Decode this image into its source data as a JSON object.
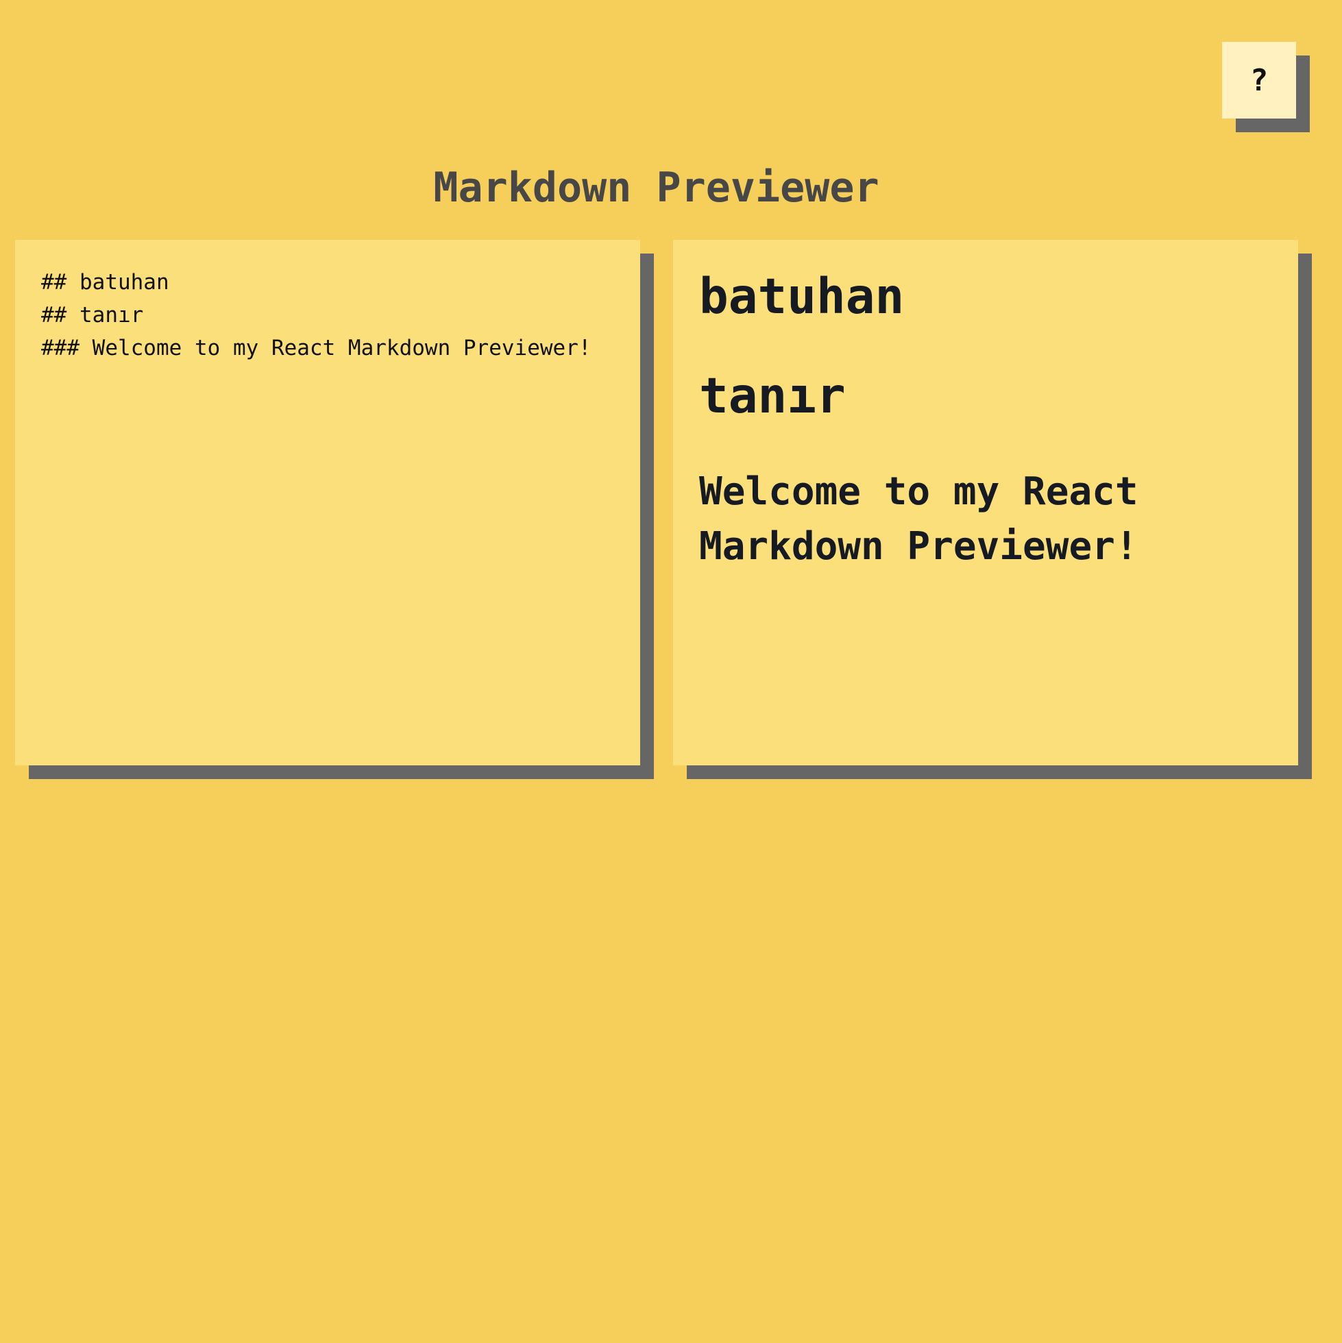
{
  "help_button": {
    "label": "?"
  },
  "header": {
    "title": "Markdown Previewer"
  },
  "editor": {
    "content": "## batuhan\n## tanır\n### Welcome to my React Markdown Previewer!"
  },
  "preview": {
    "headings": [
      {
        "level": 2,
        "text": "batuhan"
      },
      {
        "level": 2,
        "text": "tanır"
      },
      {
        "level": 3,
        "text": "Welcome to my React Markdown Previewer!"
      }
    ]
  },
  "colors": {
    "background": "#f6cf5a",
    "panel": "#fbdf7b",
    "shadow": "#666666",
    "help_button_bg": "#fff1c0",
    "title_text": "#474747"
  }
}
